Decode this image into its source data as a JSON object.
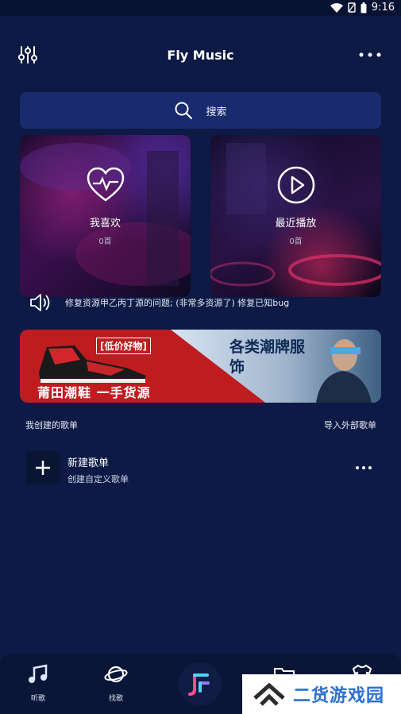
{
  "status_bar": {
    "time": "9:16",
    "icons": [
      "wifi-icon",
      "no-sim-icon",
      "battery-icon"
    ]
  },
  "header": {
    "title": "Fly Music",
    "left_icon": "equalizer-settings-icon",
    "right_icon": "more-horizontal-icon"
  },
  "search": {
    "placeholder": "搜索",
    "icon": "search-icon"
  },
  "cards": [
    {
      "label": "我喜欢",
      "count": "0首",
      "icon": "heart-pulse-icon"
    },
    {
      "label": "最近播放",
      "count": "0首",
      "icon": "play-circle-icon"
    }
  ],
  "notice": {
    "icon": "speaker-icon",
    "text": "修复资源甲乙丙丁源的问题; (非常多资源了) 修复已知bug"
  },
  "banner": {
    "tag": "[低价好物]",
    "slogan": "莆田潮鞋 一手货源",
    "headline": "各类潮牌服饰"
  },
  "section": {
    "title": "我创建的歌单",
    "action": "导入外部歌单"
  },
  "playlist": {
    "title": "新建歌单",
    "subtitle": "创建自定义歌单",
    "thumb_icon": "plus-icon",
    "more_icon": "more-horizontal-icon"
  },
  "tabs": [
    {
      "label": "听歌",
      "icon": "music-note-icon"
    },
    {
      "label": "找歌",
      "icon": "planet-icon"
    },
    {
      "label": "",
      "icon": "app-logo-icon"
    },
    {
      "label": "",
      "icon": "folder-icon"
    },
    {
      "label": "",
      "icon": "shirt-icon"
    }
  ],
  "watermark": {
    "text": "二货游戏园"
  },
  "colors": {
    "background": "#0c1a45",
    "search_bg": "#1a2a6e",
    "tabbar_bg": "#0a1638",
    "banner_red": "#bf1c1f"
  }
}
